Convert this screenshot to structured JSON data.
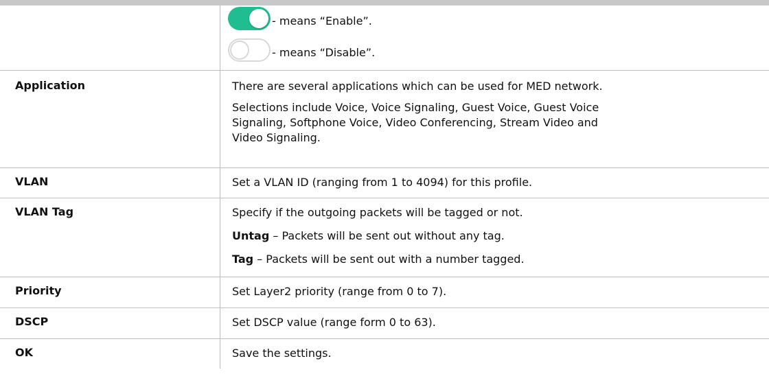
{
  "toggle_legend": {
    "enable_text": "- means “Enable”.",
    "disable_text": "- means “Disable”."
  },
  "rows": {
    "application": {
      "label": "Application",
      "line1": "There are several applications which can be used for MED network.",
      "line2": "Selections include Voice, Voice Signaling, Guest Voice, Guest Voice",
      "line3": "Signaling, Softphone Voice, Video Conferencing, Stream Video and",
      "line4": "Video Signaling."
    },
    "vlan": {
      "label": "VLAN",
      "desc": "Set a VLAN ID (ranging from 1 to 4094) for this profile."
    },
    "vlan_tag": {
      "label": "VLAN Tag",
      "desc": "Specify if the outgoing packets will be tagged or not.",
      "untag_term": "Untag",
      "untag_desc": " – Packets will be sent out without any tag.",
      "tag_term": "Tag",
      "tag_desc": " – Packets will be sent out with a number tagged."
    },
    "priority": {
      "label": "Priority",
      "desc": "Set Layer2 priority (range from 0 to 7)."
    },
    "dscp": {
      "label": "DSCP",
      "desc": "Set DSCP value (range form 0 to 63)."
    },
    "ok": {
      "label": "OK",
      "desc": "Save the settings."
    }
  },
  "colors": {
    "toggle_on": "#1fbd8f",
    "toggle_off_border": "#d8d8d8",
    "grid": "#bcbcbc"
  }
}
